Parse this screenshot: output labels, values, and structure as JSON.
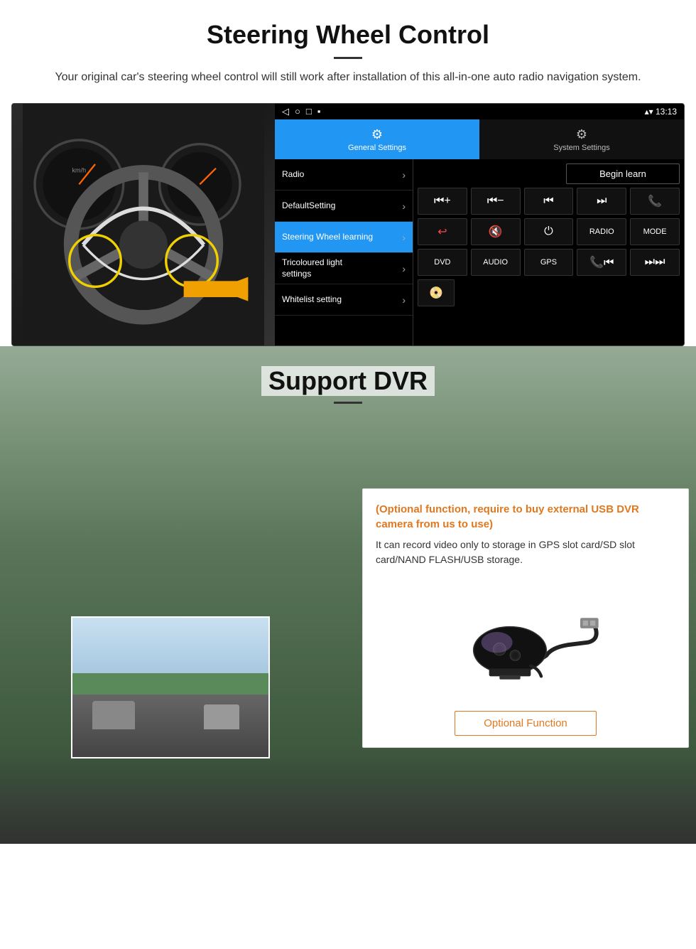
{
  "steering_section": {
    "title": "Steering Wheel Control",
    "description": "Your original car's steering wheel control will still work after installation of this all-in-one auto radio navigation system.",
    "status_bar": {
      "back_icon": "◁",
      "home_icon": "○",
      "square_icon": "□",
      "menu_icon": "▪",
      "time": "13:13",
      "wifi_icon": "▾",
      "signal_icon": "▴"
    },
    "tabs": [
      {
        "id": "general",
        "icon": "⚙",
        "label": "General Settings",
        "active": true
      },
      {
        "id": "system",
        "icon": "🔧",
        "label": "System Settings",
        "active": false
      }
    ],
    "menu_items": [
      {
        "id": "radio",
        "label": "Radio",
        "active": false
      },
      {
        "id": "default",
        "label": "DefaultSetting",
        "active": false
      },
      {
        "id": "steering",
        "label": "Steering Wheel learning",
        "active": true
      },
      {
        "id": "tricolour",
        "label": "Tricoloured light settings",
        "active": false
      },
      {
        "id": "whitelist",
        "label": "Whitelist setting",
        "active": false
      }
    ],
    "begin_learn_label": "Begin learn",
    "control_buttons": [
      [
        "⏮+",
        "⏮-",
        "⏮⏮",
        "⏭⏭",
        "📞"
      ],
      [
        "↩",
        "🔇x",
        "⏻",
        "RADIO",
        "MODE"
      ],
      [
        "DVD",
        "AUDIO",
        "GPS",
        "📞⏮",
        "⏭⏭"
      ]
    ],
    "extra_icon": "📀"
  },
  "dvr_section": {
    "title": "Support DVR",
    "card": {
      "optional_text": "(Optional function, require to buy external USB DVR camera from us to use)",
      "description": "It can record video only to storage in GPS slot card/SD slot card/NAND FLASH/USB storage.",
      "optional_function_label": "Optional Function"
    }
  }
}
